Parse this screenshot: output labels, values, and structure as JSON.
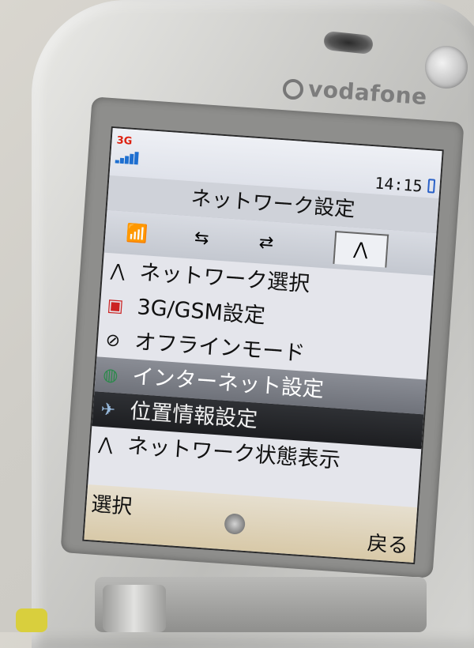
{
  "brand": {
    "logo_text": "vodafone"
  },
  "status": {
    "network": "3G",
    "time": "14:15",
    "signal_level": 1.0
  },
  "screen_title": "ネットワーク設定",
  "tabs": [
    {
      "icon": "phone-antenna-icon",
      "active": false
    },
    {
      "icon": "arrows-transfer-icon",
      "active": false
    },
    {
      "icon": "arrows-antenna-icon",
      "active": false
    },
    {
      "icon": "antenna-pair-icon",
      "active": true
    }
  ],
  "menu": [
    {
      "label": "ネットワーク選択",
      "icon": "antenna-pair-icon",
      "state": "normal"
    },
    {
      "label": "3G/GSM設定",
      "icon": "sim-3g-gsm-icon",
      "state": "normal"
    },
    {
      "label": "オフラインモード",
      "icon": "offline-icon",
      "state": "normal"
    },
    {
      "label": "インターネット設定",
      "icon": "globe-icon",
      "state": "dim"
    },
    {
      "label": "位置情報設定",
      "icon": "location-antenna-icon",
      "state": "selected"
    },
    {
      "label": "ネットワーク状態表示",
      "icon": "network-status-icon",
      "state": "normal"
    }
  ],
  "softkeys": {
    "left": "選択",
    "right": "戻る"
  },
  "colors": {
    "accent_blue": "#1e6fd0",
    "status_red": "#d21111",
    "highlight": "#1d1e21"
  }
}
